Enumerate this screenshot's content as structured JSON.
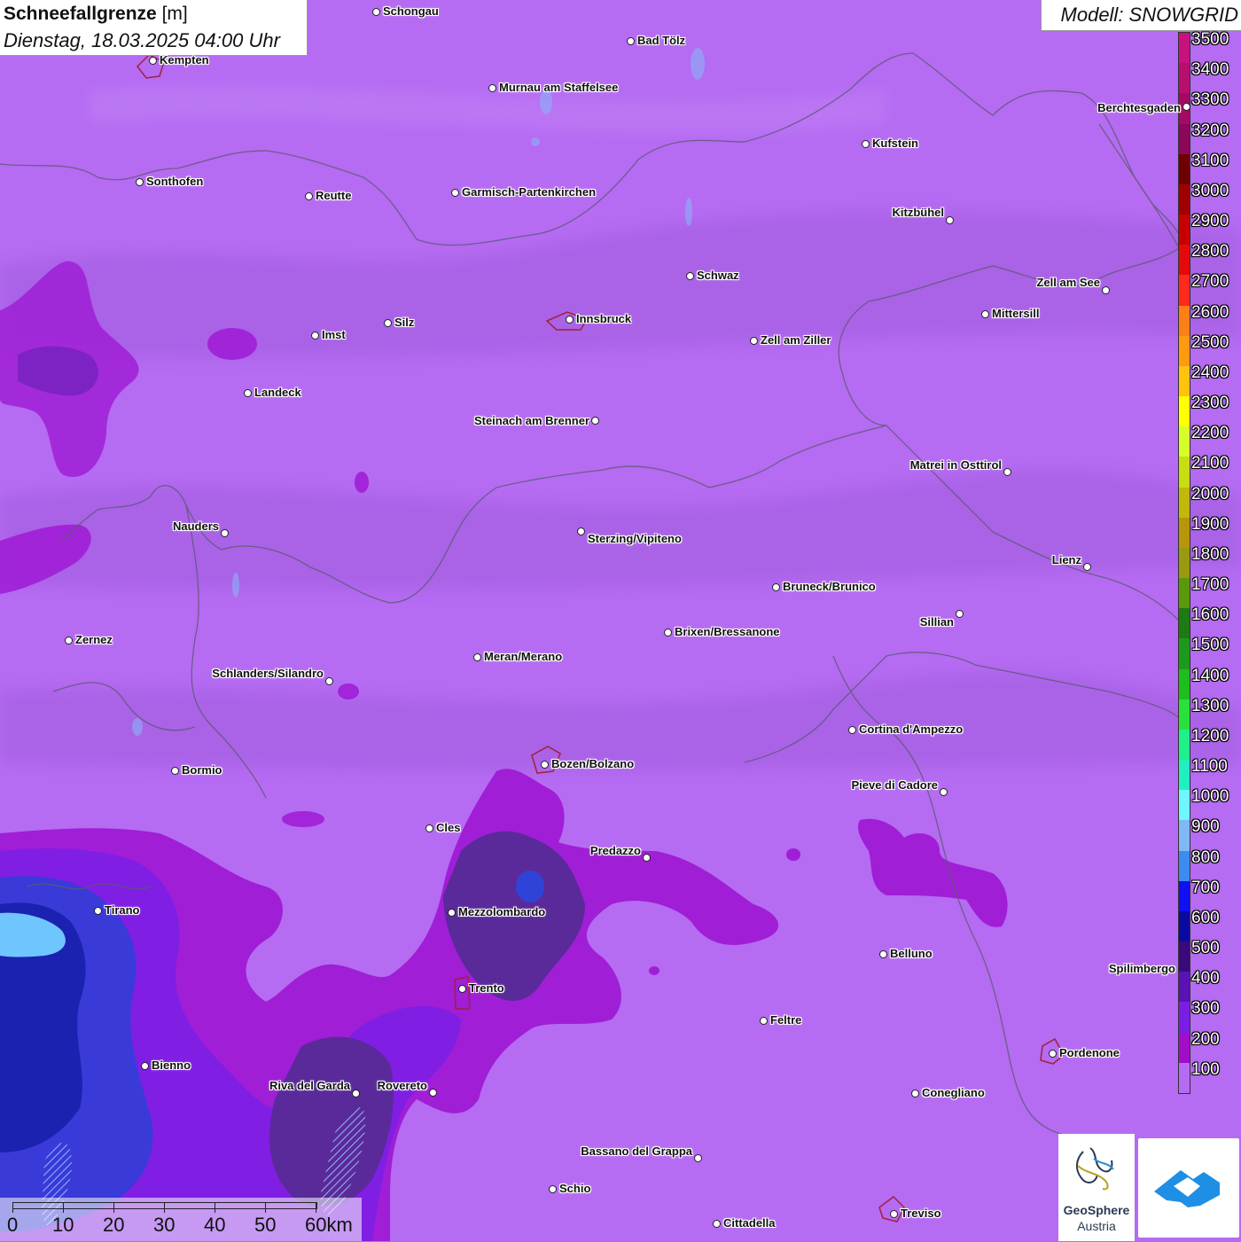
{
  "header": {
    "title_bold": "Schneefallgrenze",
    "title_unit": "[m]",
    "datetime": "Dienstag, 18.03.2025 04:00 Uhr"
  },
  "model": {
    "label": "Modell: SNOWGRID"
  },
  "legend": {
    "unit": "m",
    "items": [
      {
        "label": "3500",
        "color": "#c7127d"
      },
      {
        "label": "3400",
        "color": "#b80f6f"
      },
      {
        "label": "3300",
        "color": "#a50a63"
      },
      {
        "label": "3200",
        "color": "#8c0757"
      },
      {
        "label": "3100",
        "color": "#6e0202"
      },
      {
        "label": "3000",
        "color": "#a00000"
      },
      {
        "label": "2900",
        "color": "#c80000"
      },
      {
        "label": "2800",
        "color": "#e50a0a"
      },
      {
        "label": "2700",
        "color": "#ff2a1a"
      },
      {
        "label": "2600",
        "color": "#ff7f17"
      },
      {
        "label": "2500",
        "color": "#ff9a10"
      },
      {
        "label": "2400",
        "color": "#ffc20d"
      },
      {
        "label": "2300",
        "color": "#ffff00"
      },
      {
        "label": "2200",
        "color": "#d6ff2a"
      },
      {
        "label": "2100",
        "color": "#c8dd12"
      },
      {
        "label": "2000",
        "color": "#c2b80a"
      },
      {
        "label": "1900",
        "color": "#b8960a"
      },
      {
        "label": "1800",
        "color": "#9a9a10"
      },
      {
        "label": "1700",
        "color": "#5a9a0a"
      },
      {
        "label": "1600",
        "color": "#1e7a12"
      },
      {
        "label": "1500",
        "color": "#1c9a1c"
      },
      {
        "label": "1400",
        "color": "#1fbe1f"
      },
      {
        "label": "1300",
        "color": "#2ae03a"
      },
      {
        "label": "1200",
        "color": "#1ef08c"
      },
      {
        "label": "1100",
        "color": "#20f0c0"
      },
      {
        "label": "1000",
        "color": "#6ff6ff"
      },
      {
        "label": "900",
        "color": "#80b8f4"
      },
      {
        "label": "800",
        "color": "#3c8cf0"
      },
      {
        "label": "700",
        "color": "#1010f0"
      },
      {
        "label": "600",
        "color": "#0a0aa0"
      },
      {
        "label": "500",
        "color": "#3a0a7a"
      },
      {
        "label": "400",
        "color": "#5a12b4"
      },
      {
        "label": "300",
        "color": "#7a1ee6"
      },
      {
        "label": "200",
        "color": "#a20ec8"
      },
      {
        "label": "100",
        "color": "#b56bf2"
      }
    ]
  },
  "cities": [
    {
      "name": "Schongau",
      "label_side": "right"
    },
    {
      "name": "Bad Tölz",
      "label_side": "right"
    },
    {
      "name": "Kempten",
      "label_side": "right"
    },
    {
      "name": "Murnau am Staffelsee",
      "label_side": "right"
    },
    {
      "name": "Berchtesgaden",
      "label_side": "left"
    },
    {
      "name": "Kufstein",
      "label_side": "right"
    },
    {
      "name": "Sonthofen",
      "label_side": "right"
    },
    {
      "name": "Reutte",
      "label_side": "right"
    },
    {
      "name": "Garmisch-Partenkirchen",
      "label_side": "right"
    },
    {
      "name": "Kitzbühel",
      "label_side": "left"
    },
    {
      "name": "Schwaz",
      "label_side": "right"
    },
    {
      "name": "Zell am See",
      "label_side": "left"
    },
    {
      "name": "Innsbruck",
      "label_side": "right"
    },
    {
      "name": "Mittersill",
      "label_side": "right"
    },
    {
      "name": "Imst",
      "label_side": "right"
    },
    {
      "name": "Silz",
      "label_side": "right"
    },
    {
      "name": "Zell am Ziller",
      "label_side": "right"
    },
    {
      "name": "Landeck",
      "label_side": "right"
    },
    {
      "name": "Steinach am Brenner",
      "label_side": "left"
    },
    {
      "name": "Matrei in Osttirol",
      "label_side": "left"
    },
    {
      "name": "Nauders",
      "label_side": "left"
    },
    {
      "name": "Sterzing/Vipiteno",
      "label_side": "right"
    },
    {
      "name": "Lienz",
      "label_side": "left"
    },
    {
      "name": "Bruneck/Brunico",
      "label_side": "right"
    },
    {
      "name": "Sillian",
      "label_side": "left"
    },
    {
      "name": "Zernez",
      "label_side": "right"
    },
    {
      "name": "Brixen/Bressanone",
      "label_side": "right"
    },
    {
      "name": "Meran/Merano",
      "label_side": "right"
    },
    {
      "name": "Schlanders/Silandro",
      "label_side": "left"
    },
    {
      "name": "Cortina d'Ampezzo",
      "label_side": "right"
    },
    {
      "name": "Bormio",
      "label_side": "right"
    },
    {
      "name": "Bozen/Bolzano",
      "label_side": "right"
    },
    {
      "name": "Pieve di Cadore",
      "label_side": "left"
    },
    {
      "name": "Cles",
      "label_side": "right"
    },
    {
      "name": "Predazzo",
      "label_side": "left"
    },
    {
      "name": "Tirano",
      "label_side": "right"
    },
    {
      "name": "Mezzolombardo",
      "label_side": "right"
    },
    {
      "name": "Belluno",
      "label_side": "right"
    },
    {
      "name": "Spilimbergo",
      "label_side": "right"
    },
    {
      "name": "Trento",
      "label_side": "right"
    },
    {
      "name": "Feltre",
      "label_side": "right"
    },
    {
      "name": "Pordenone",
      "label_side": "right"
    },
    {
      "name": "Bienno",
      "label_side": "right"
    },
    {
      "name": "Riva del Garda",
      "label_side": "left"
    },
    {
      "name": "Rovereto",
      "label_side": "left"
    },
    {
      "name": "Conegliano",
      "label_side": "right"
    },
    {
      "name": "Bassano del Grappa",
      "label_side": "left"
    },
    {
      "name": "Schio",
      "label_side": "right"
    },
    {
      "name": "Treviso",
      "label_side": "right"
    },
    {
      "name": "Cittadella",
      "label_side": "right"
    }
  ],
  "scale": {
    "labels": [
      "0",
      "10",
      "20",
      "30",
      "40",
      "50",
      "60km"
    ]
  },
  "logos": {
    "geosphere_line1": "GeoSphere",
    "geosphere_line2": "Austria"
  }
}
